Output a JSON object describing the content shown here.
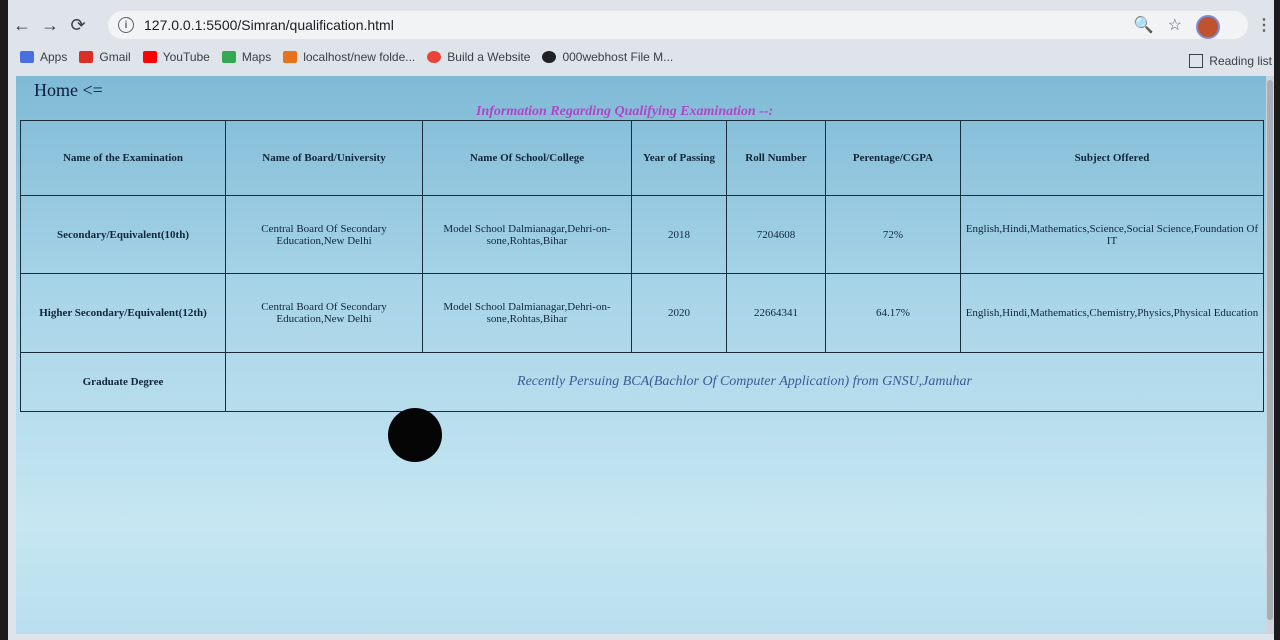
{
  "browser": {
    "url": "127.0.0.1:5500/Simran/qualification.html",
    "bookmarks": [
      "Apps",
      "Gmail",
      "YouTube",
      "Maps",
      "localhost/new folde...",
      "Build a Website",
      "000webhost File M..."
    ],
    "reading_list": "Reading list"
  },
  "page": {
    "home_link": "Home <=",
    "caption": "Information Regarding Qualifying Examination --:",
    "headers": [
      "Name of the Examination",
      "Name of Board/University",
      "Name Of School/College",
      "Year of Passing",
      "Roll Number",
      "Perentage/CGPA",
      "Subject Offered"
    ],
    "rows": [
      {
        "exam": "Secondary/Equivalent(10th)",
        "board": "Central Board Of Secondary Education,New Delhi",
        "school": "Model School Dalmianagar,Dehri-on-sone,Rohtas,Bihar",
        "year": "2018",
        "roll": "7204608",
        "percentage": "72%",
        "subjects": "English,Hindi,Mathematics,Science,Social Science,Foundation Of IT"
      },
      {
        "exam": "Higher Secondary/Equivalent(12th)",
        "board": "Central Board Of Secondary Education,New Delhi",
        "school": "Model School Dalmianagar,Dehri-on-sone,Rohtas,Bihar",
        "year": "2020",
        "roll": "22664341",
        "percentage": "64.17%",
        "subjects": "English,Hindi,Mathematics,Chemistry,Physics,Physical Education"
      }
    ],
    "graduate": {
      "exam": "Graduate Degree",
      "note": "Recently Persuing BCA(Bachlor Of Computer Application) from GNSU,Jamuhar"
    }
  }
}
